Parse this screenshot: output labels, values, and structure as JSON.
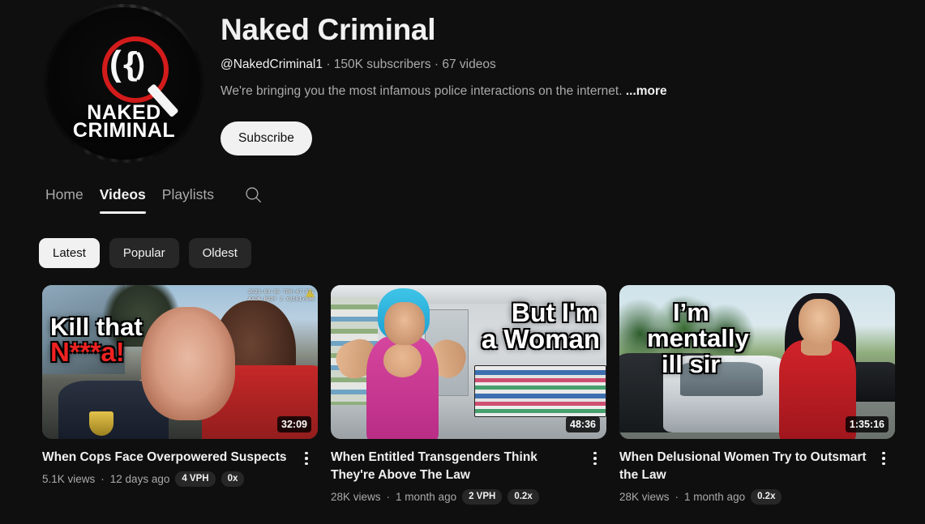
{
  "channel": {
    "name": "Naked Criminal",
    "handle": "@NakedCriminal1",
    "subscribers": "150K subscribers",
    "video_count": "67 videos",
    "separator": "·",
    "description": "We're bringing you the most infamous police interactions on the internet.",
    "more_label": "...more",
    "subscribe_label": "Subscribe",
    "avatar": {
      "logo_line1": "NAKED",
      "logo_line2": "CRIMINAL",
      "icon": "magnifier-logo-icon",
      "ring_color": "#d31b1b"
    }
  },
  "tabs": [
    {
      "label": "Home",
      "active": false
    },
    {
      "label": "Videos",
      "active": true
    },
    {
      "label": "Playlists",
      "active": false
    }
  ],
  "search": {
    "icon": "search-icon"
  },
  "filters": [
    {
      "label": "Latest",
      "active": true
    },
    {
      "label": "Popular",
      "active": false
    },
    {
      "label": "Oldest",
      "active": false
    }
  ],
  "videos": [
    {
      "title": "When Cops Face Overpowered Suspects",
      "views": "5.1K views",
      "age": "12 days ago",
      "duration": "32:09",
      "badges": [
        "4 VPH",
        "0x"
      ],
      "thumb_text_line1": "Kill that",
      "thumb_text_line2": "N***a!",
      "thumb_stamp_line1": "2023-03-25 T00:47:372",
      "thumb_stamp_line2": "AXON BODY 2 X81517606"
    },
    {
      "title": "When Entitled Transgenders Think They're Above The Law",
      "views": "28K views",
      "age": "1 month ago",
      "duration": "48:36",
      "badges": [
        "2 VPH",
        "0.2x"
      ],
      "thumb_text_line1": "But I'm",
      "thumb_text_line2": "a Woman"
    },
    {
      "title": "When Delusional Women Try to Outsmart the Law",
      "views": "28K views",
      "age": "1 month ago",
      "duration": "1:35:16",
      "badges": [
        "0.2x"
      ],
      "thumb_text_line1": "I’m",
      "thumb_text_line2": "mentally",
      "thumb_text_line3": "ill sir"
    }
  ],
  "colors": {
    "background": "#0f0f0f",
    "text_primary": "#f1f1f1",
    "text_secondary": "#aaaaaa",
    "chip_bg": "#272727",
    "accent_red": "#d31b1b"
  }
}
